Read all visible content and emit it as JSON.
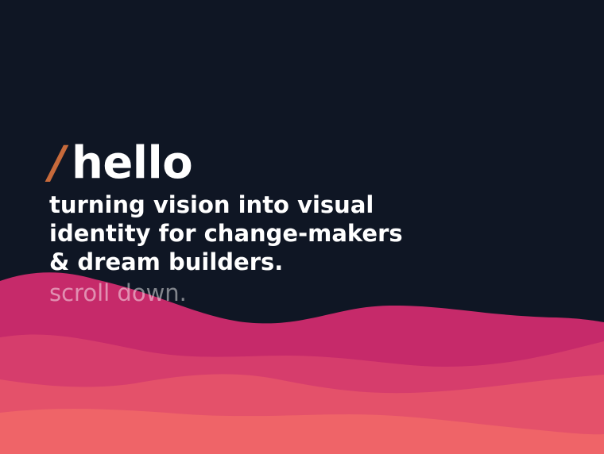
{
  "hero": {
    "slash": "/",
    "title": "hello",
    "tagline": "turning vision into visual\nidentity for change-makers\n& dream builders.",
    "scroll_label": "scroll down."
  },
  "colors": {
    "background": "#0f1624",
    "accent": "#c76a3b",
    "wave_1": "#c62a6a",
    "wave_2": "#d63d6c",
    "wave_3": "#e4516a",
    "wave_4": "#ef6468"
  }
}
